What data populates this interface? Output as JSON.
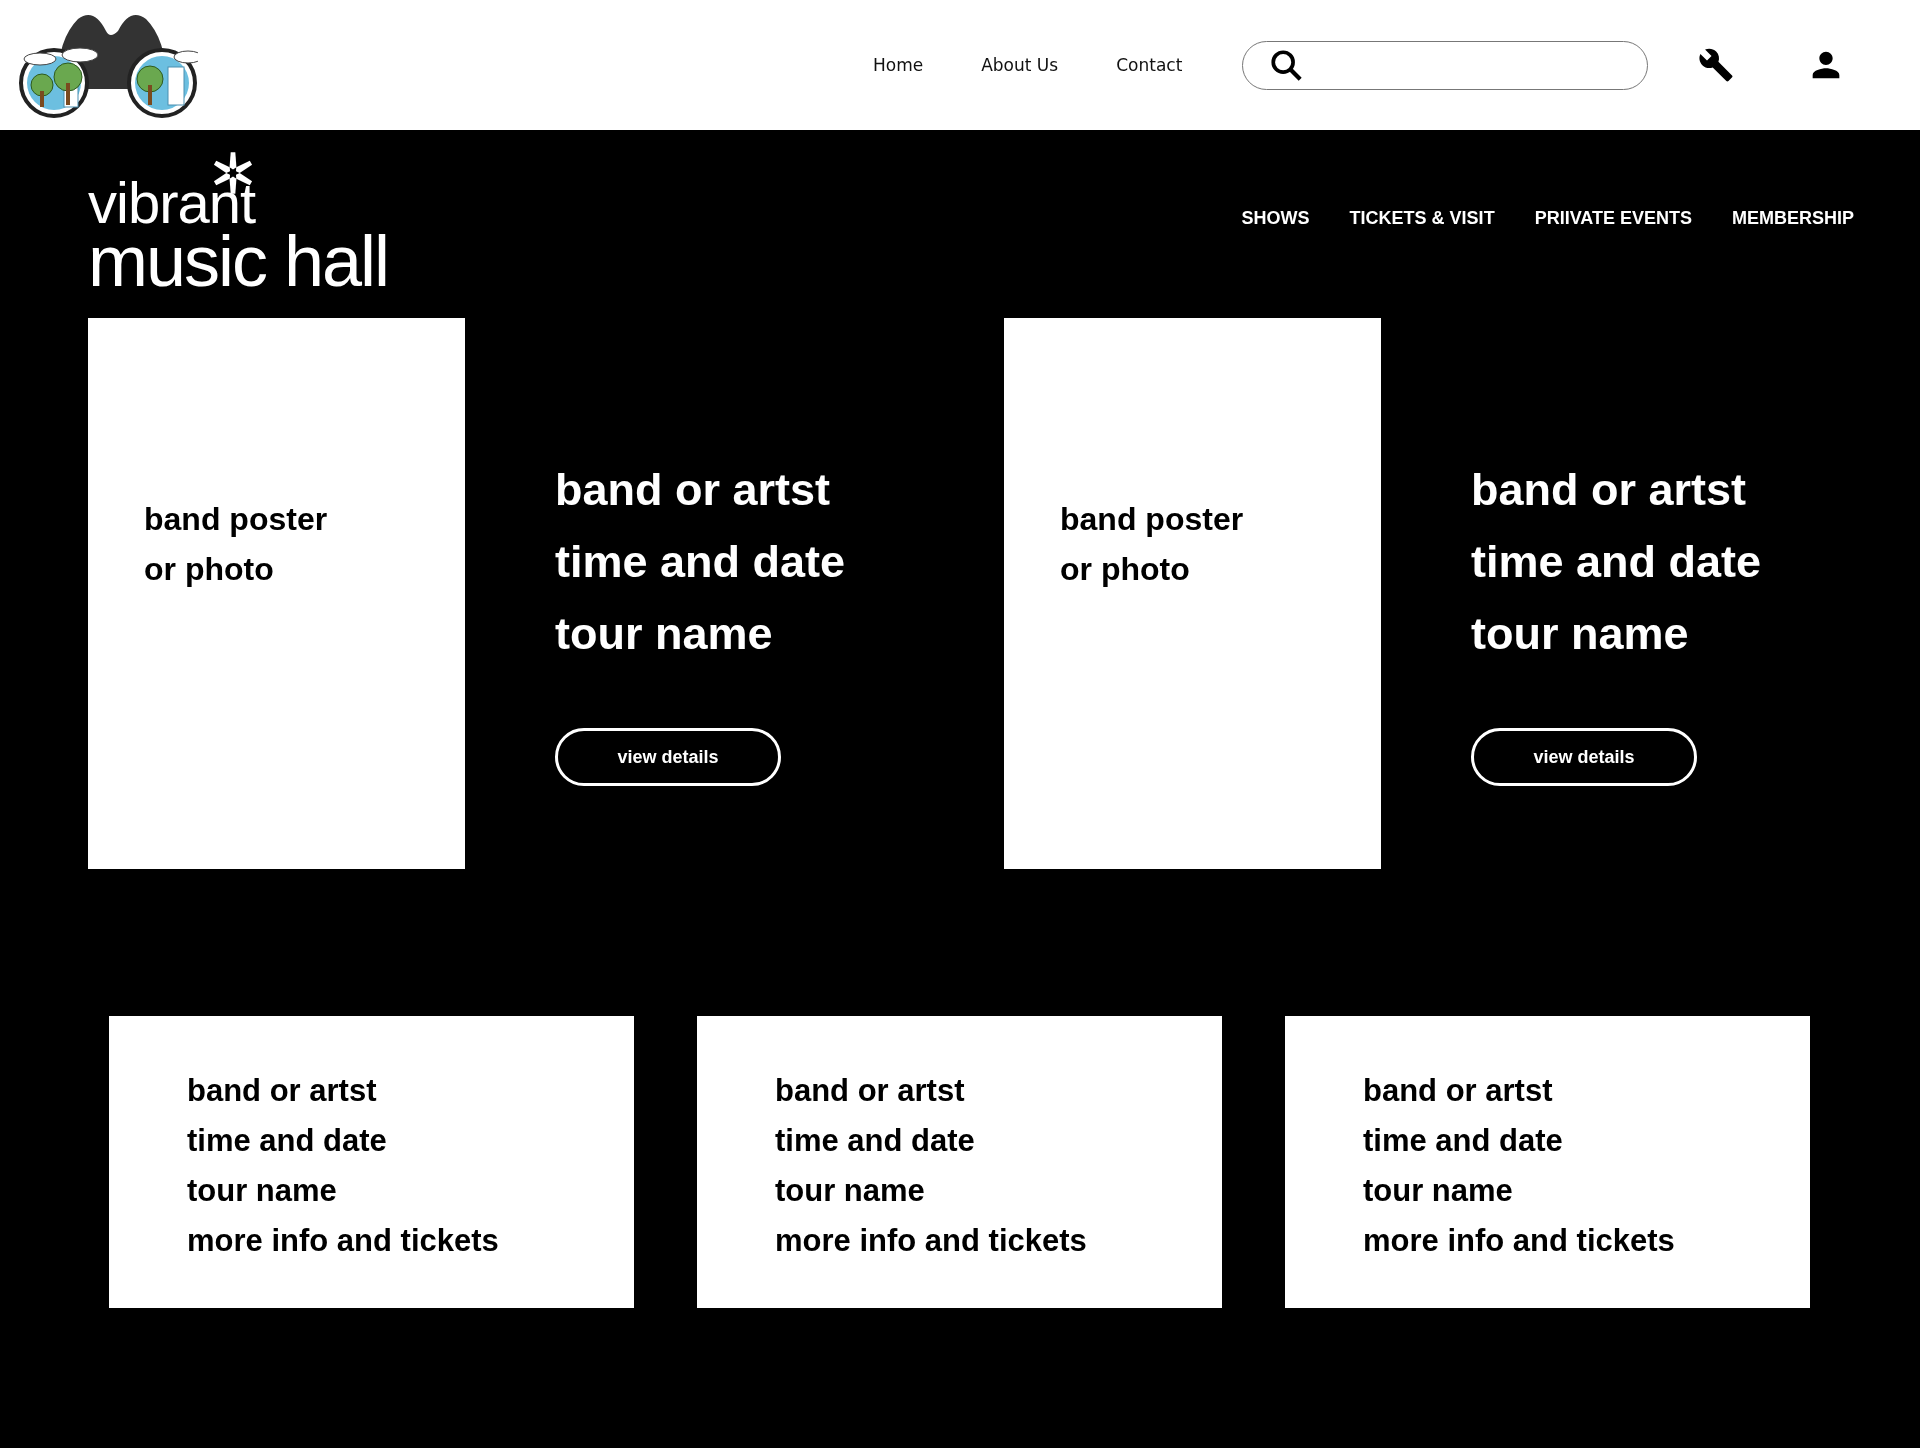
{
  "header": {
    "links": [
      "Home",
      "About Us",
      "Contact"
    ]
  },
  "brand": {
    "lines": [
      "vibrant",
      "music hall"
    ]
  },
  "main_nav": [
    "SHOWS",
    "TICKETS & VISIT",
    "PRIIVATE EVENTS",
    "MEMBERSHIP"
  ],
  "featured": [
    {
      "poster_text": [
        "band poster",
        "or photo"
      ],
      "lines": [
        "band or artst",
        "time and date",
        "tour name"
      ],
      "button": "view details"
    },
    {
      "poster_text": [
        "band poster",
        "or photo"
      ],
      "lines": [
        "band or artst",
        "time and date",
        "tour name"
      ],
      "button": "view details"
    }
  ],
  "cards": [
    {
      "lines": [
        "band or artst",
        "time and date",
        "tour name",
        "more info and tickets"
      ]
    },
    {
      "lines": [
        "band or artst",
        "time and date",
        "tour name",
        "more info and tickets"
      ]
    },
    {
      "lines": [
        "band or artst",
        "time and date",
        "tour name",
        "more info and tickets"
      ]
    }
  ]
}
